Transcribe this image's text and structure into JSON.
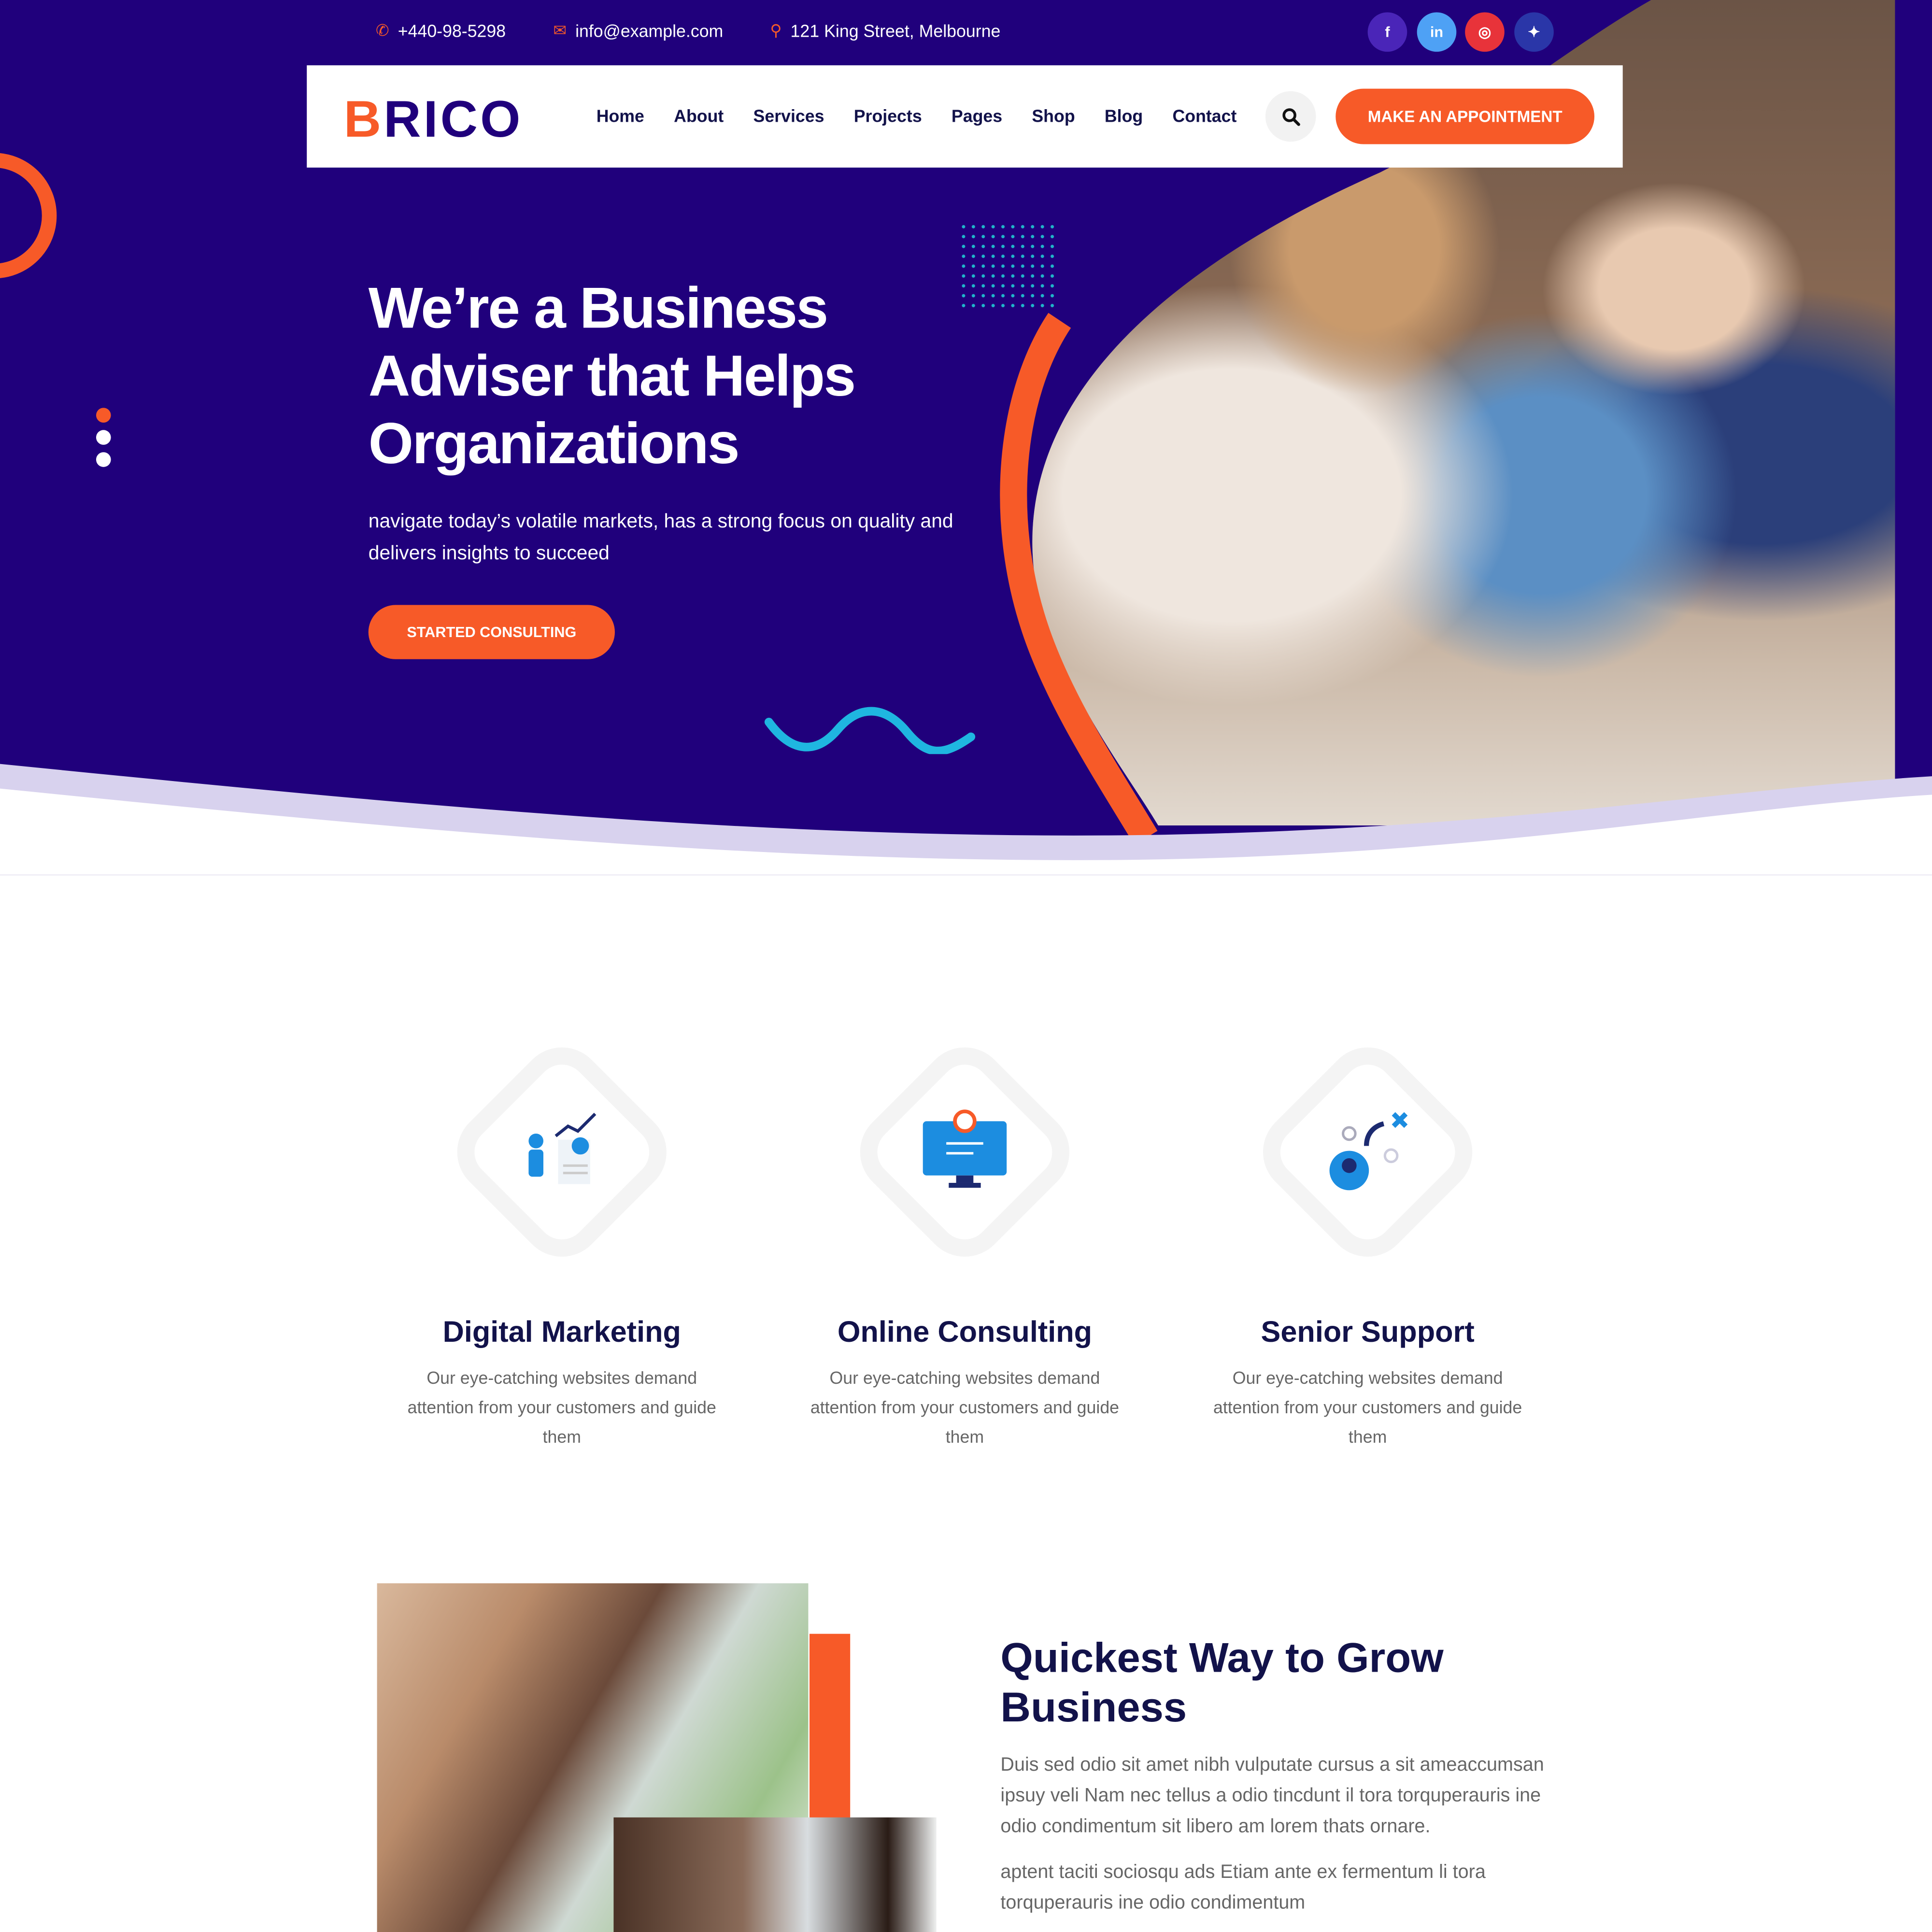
{
  "topbar": {
    "phone": "+440-98-5298",
    "email": "info@example.com",
    "address": "121 King Street, Melbourne",
    "social": [
      {
        "icon": "facebook-icon",
        "glyph": "f",
        "color": "#4a25b8"
      },
      {
        "icon": "linkedin-icon",
        "glyph": "in",
        "color": "#4ea1f5"
      },
      {
        "icon": "instagram-icon",
        "glyph": "◎",
        "color": "#e8333a"
      },
      {
        "icon": "twitter-icon",
        "glyph": "✦",
        "color": "#2a36a8"
      }
    ]
  },
  "header": {
    "logo_first": "B",
    "logo_rest": "RICO",
    "nav": [
      "Home",
      "About",
      "Services",
      "Projects",
      "Pages",
      "Shop",
      "Blog",
      "Contact"
    ],
    "cta": "MAKE AN APPOINTMENT"
  },
  "hero": {
    "title": "We’re a Business Adviser that Helps Organizations",
    "subtitle": "navigate today’s volatile markets, has a strong focus on quality and delivers insights to succeed",
    "button": "STARTED CONSULTING"
  },
  "services": [
    {
      "title": "Digital Marketing",
      "desc": "Our eye-catching websites demand attention from your customers and guide them",
      "icon": "growth-chart-icon"
    },
    {
      "title": "Online Consulting",
      "desc": "Our eye-catching websites demand attention from your customers and guide them",
      "icon": "monitor-icon"
    },
    {
      "title": "Senior Support",
      "desc": "Our eye-catching websites demand attention from your customers and guide them",
      "icon": "support-path-icon"
    }
  ],
  "about": {
    "title": "Quickest Way to Grow Business",
    "p1": "Duis sed odio sit amet nibh vulputate cursus a sit ameaccumsan ipsuy veli Nam nec tellus a odio tincdunt il tora torquperauris ine odio condimentum sit libero am lorem thats ornare.",
    "p2": "aptent taciti sociosqu ads Etiam ante ex fermentum li tora torquperauris ine odio condimentum"
  },
  "colors": {
    "primary": "#20007c",
    "accent": "#f75a28",
    "heading": "#12124a",
    "cyan": "#1fb6e0"
  }
}
